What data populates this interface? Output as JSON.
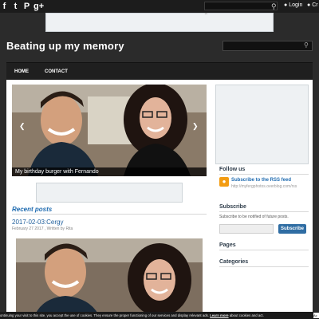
{
  "topbar": {
    "social_icons": [
      "facebook-icon",
      "twitter-icon",
      "pinterest-icon",
      "google-plus-icon"
    ],
    "social_glyphs": [
      "f",
      "t",
      "P",
      "g+"
    ],
    "login_label": "Login",
    "create_label": "Cr"
  },
  "header": {
    "site_title": "Beating up my memory"
  },
  "nav": {
    "items": [
      "HOME",
      "CONTACT"
    ]
  },
  "slider": {
    "caption": "My birthday burger with Fernando"
  },
  "main": {
    "recent_title": "Recent posts",
    "post_title": "2017-02-03:Cergy",
    "post_meta": "February 27 2017 , Written by Rita"
  },
  "sidebar": {
    "follow_title": "Follow us",
    "rss_label": "Subscribe to the RSS feed",
    "rss_sub": "http://myfergphotos.overblog.com/rss",
    "subscribe_title": "Subscribe",
    "subscribe_text": "Subscribe to be notified of future posts.",
    "subscribe_button": "Subscribe",
    "pages_title": "Pages",
    "categories_title": "Categories"
  },
  "cookie": {
    "text_before": "ontinuing your visit to this site, you accept the use of cookies. They ensure the proper functioning of our services and display relevant ads.",
    "link": "Learn more",
    "text_after": "about cookies and act.",
    "button": "Ac"
  },
  "colors": {
    "accent": "#1f6bb0",
    "background": "#2b2b2b",
    "subscribe_button": "#2f6da3",
    "rss": "#f39c12"
  }
}
